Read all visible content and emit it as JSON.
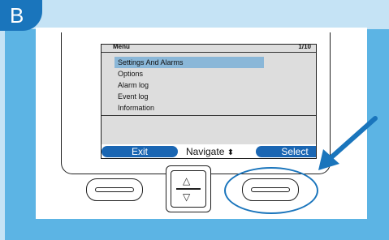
{
  "step_badge": "B",
  "screen": {
    "title": "Menu",
    "page": "1/10",
    "items": [
      {
        "label": "Settings And Alarms",
        "selected": true
      },
      {
        "label": "Options",
        "selected": false
      },
      {
        "label": "Alarm log",
        "selected": false
      },
      {
        "label": "Event log",
        "selected": false
      },
      {
        "label": "Information",
        "selected": false
      }
    ],
    "softkeys": {
      "exit": "Exit",
      "navigate": "Navigate",
      "navigate_icon": "⬍",
      "select": "Select"
    }
  },
  "hardware_buttons": {
    "up_icon": "△",
    "down_icon": "▽"
  },
  "colors": {
    "accent": "#1a75bc",
    "selected_row": "#8ab7d8",
    "softkey": "#1a66b3"
  }
}
